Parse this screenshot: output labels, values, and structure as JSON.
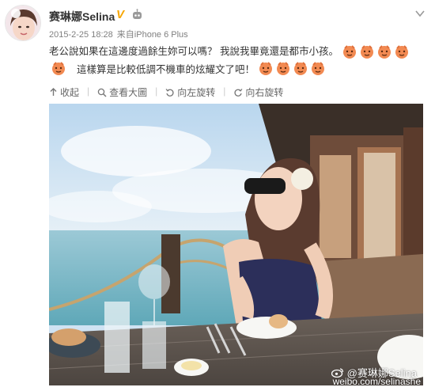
{
  "user": {
    "name": "赛琳娜Selina",
    "verified_icon": "vip-v-icon",
    "robot_icon": "robot-icon"
  },
  "meta": {
    "timestamp": "2015-2-25 18:28",
    "source_prefix": "来自",
    "source": "iPhone 6 Plus"
  },
  "content": {
    "line1": "老公說如果在這邊度過餘生妳可以嗎？ 我說我畢竟還是都市小孩。",
    "line2": "這樣算是比較低調不機車的炫耀文了吧！",
    "emoji_name": "face-emoji-icon"
  },
  "toolbar": {
    "collapse": "收起",
    "view_large": "查看大圖",
    "rotate_left": "向左旋转",
    "rotate_right": "向右旋转"
  },
  "watermark": {
    "line1": "@赛琳娜Selina",
    "line2": "weibo.com/selinashe"
  },
  "colors": {
    "accent_text": "#333333",
    "meta_text": "#808080",
    "vip_badge": "#f7a600",
    "emoji": "#f28a52"
  }
}
